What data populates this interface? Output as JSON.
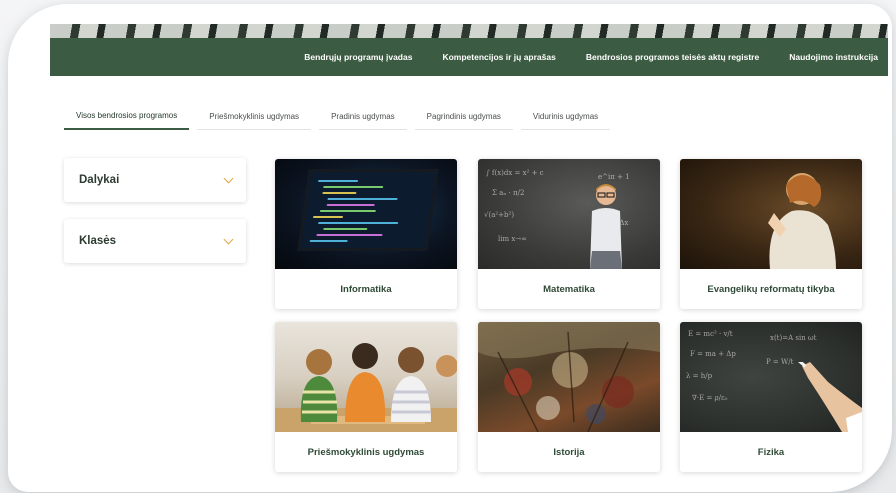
{
  "nav": {
    "links": [
      "Bendrųjų programų įvadas",
      "Kompetencijos ir jų aprašas",
      "Bendrosios programos teisės aktų registre",
      "Naudojimo instrukcija"
    ]
  },
  "tabs": [
    "Visos bendrosios programos",
    "Priešmokyklinis ugdymas",
    "Pradinis ugdymas",
    "Pagrindinis ugdymas",
    "Vidurinis ugdymas"
  ],
  "active_tab": "Visos bendrosios programos",
  "filters": [
    {
      "label": "Dalykai",
      "icon": "chevron-down-icon"
    },
    {
      "label": "Klasės",
      "icon": "chevron-down-icon"
    }
  ],
  "cards": [
    {
      "title": "Informatika",
      "image": "laptop-code-image"
    },
    {
      "title": "Matematika",
      "image": "boy-blackboard-image"
    },
    {
      "title": "Evangelikų reformatų tikyba",
      "image": "praying-child-image"
    },
    {
      "title": "Priešmokyklinis ugdymas",
      "image": "children-classroom-image"
    },
    {
      "title": "Istorija",
      "image": "battle-painting-image"
    },
    {
      "title": "Fizika",
      "image": "chalkboard-formulas-image"
    }
  ],
  "colors": {
    "header_green": "#3b5b42",
    "title_green": "#2f4a36",
    "chevron_orange": "#e2a443"
  }
}
